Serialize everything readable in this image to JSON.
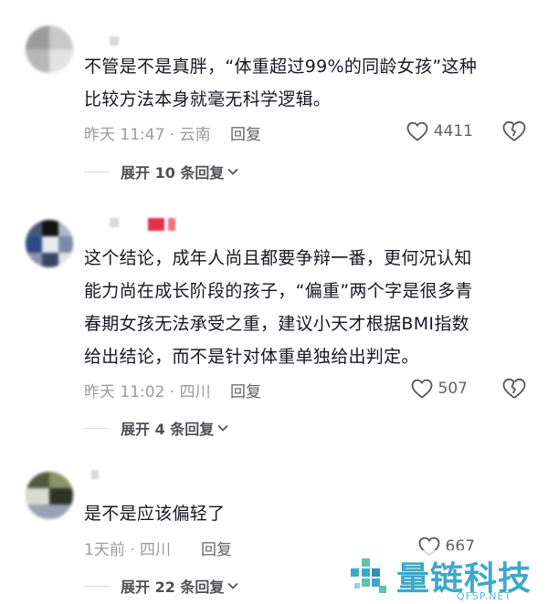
{
  "comments": [
    {
      "body": "不管是不是真胖，“体重超过99%的同龄女孩”这种\n比较方法本身就毫无科学逻辑。",
      "time": "昨天 11:47 · 云南",
      "reply_label": "回复",
      "likes": "4411",
      "expand_label": "展开 10 条回复"
    },
    {
      "body": "这个结论，成年人尚且都要争辩一番，更何况认知\n能力尚在成长阶段的孩子，“偏重”两个字是很多青\n春期女孩无法承受之重，建议小天才根据BMI指数\n给出结论，而不是针对体重单独给出判定。",
      "time": "昨天 11:02 · 四川",
      "reply_label": "回复",
      "likes": "507",
      "expand_label": "展开 4 条回复"
    },
    {
      "body": "是不是应该偏轻了",
      "time": "1天前 · 四川",
      "reply_label": "回复",
      "likes": "667",
      "expand_label": "展开 22 条回复"
    }
  ],
  "icons": {
    "like": "heart-outline-icon",
    "dislike": "broken-heart-icon",
    "expand": "chevron-down-icon"
  },
  "watermark": {
    "title": "量链科技",
    "subtitle": "QFSP.NET",
    "color": "#3ea8c9"
  }
}
